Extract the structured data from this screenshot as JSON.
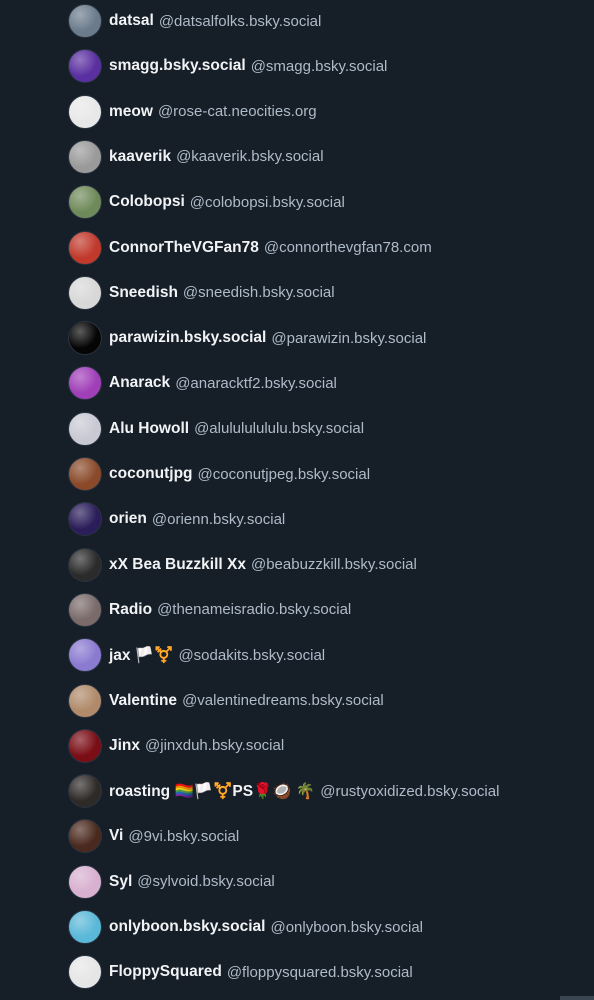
{
  "follows": [
    {
      "display_name": "datsal",
      "handle": "@datsalfolks.bsky.social",
      "avatar_color": "#6b7b8c",
      "avatar_icon": "avatar-icon"
    },
    {
      "display_name": "smagg.bsky.social",
      "handle": "@smagg.bsky.social",
      "avatar_color": "#5a2fa0",
      "avatar_icon": "avatar-icon"
    },
    {
      "display_name": "meow",
      "handle": "@rose-cat.neocities.org",
      "avatar_color": "#e8e8e8",
      "avatar_icon": "avatar-icon"
    },
    {
      "display_name": "kaaverik",
      "handle": "@kaaverik.bsky.social",
      "avatar_color": "#9a9a9a",
      "avatar_icon": "avatar-icon"
    },
    {
      "display_name": "Colobopsi",
      "handle": "@colobopsi.bsky.social",
      "avatar_color": "#6f8a5a",
      "avatar_icon": "avatar-icon"
    },
    {
      "display_name": "ConnorTheVGFan78",
      "handle": "@connorthevgfan78.com",
      "avatar_color": "#c0392b",
      "avatar_icon": "avatar-icon"
    },
    {
      "display_name": "Sneedish",
      "handle": "@sneedish.bsky.social",
      "avatar_color": "#d8d8d8",
      "avatar_icon": "avatar-icon"
    },
    {
      "display_name": "parawizin.bsky.social",
      "handle": "@parawizin.bsky.social",
      "avatar_color": "#050505",
      "avatar_icon": "avatar-icon"
    },
    {
      "display_name": "Anarack",
      "handle": "@anaracktf2.bsky.social",
      "avatar_color": "#a03fb8",
      "avatar_icon": "avatar-icon"
    },
    {
      "display_name": "Alu Howoll",
      "handle": "@alulululululu.bsky.social",
      "avatar_color": "#c9c9d4",
      "avatar_icon": "avatar-icon"
    },
    {
      "display_name": "coconutjpg",
      "handle": "@coconutjpeg.bsky.social",
      "avatar_color": "#8a4a2a",
      "avatar_icon": "avatar-icon"
    },
    {
      "display_name": "orien",
      "handle": "@orienn.bsky.social",
      "avatar_color": "#2a1d5a",
      "avatar_icon": "avatar-icon"
    },
    {
      "display_name": "xX Bea Buzzkill Xx",
      "handle": "@beabuzzkill.bsky.social",
      "avatar_color": "#2b2b2b",
      "avatar_icon": "avatar-icon"
    },
    {
      "display_name": "Radio",
      "handle": "@thenameisradio.bsky.social",
      "avatar_color": "#7a6a6a",
      "avatar_icon": "avatar-icon"
    },
    {
      "display_name": "jax 🏳️⚧️",
      "handle": "@sodakits.bsky.social",
      "avatar_color": "#8a7ad0",
      "avatar_icon": "avatar-icon"
    },
    {
      "display_name": "Valentine",
      "handle": "@valentinedreams.bsky.social",
      "avatar_color": "#b08a6a",
      "avatar_icon": "avatar-icon"
    },
    {
      "display_name": "Jinx",
      "handle": "@jinxduh.bsky.social",
      "avatar_color": "#7a0d15",
      "avatar_icon": "avatar-icon"
    },
    {
      "display_name": "roasting 🏳️‍🌈🏳️⚧️PS🌹🥥 🌴",
      "handle": "@rustyoxidized.bsky.social",
      "avatar_color": "#2e2a28",
      "avatar_icon": "avatar-icon"
    },
    {
      "display_name": "Vi",
      "handle": "@9vi.bsky.social",
      "avatar_color": "#4a2a1e",
      "avatar_icon": "avatar-icon"
    },
    {
      "display_name": "Syl",
      "handle": "@sylvoid.bsky.social",
      "avatar_color": "#d8b0d0",
      "avatar_icon": "avatar-icon"
    },
    {
      "display_name": "onlyboon.bsky.social",
      "handle": "@onlyboon.bsky.social",
      "avatar_color": "#5ab8d8",
      "avatar_icon": "avatar-icon"
    },
    {
      "display_name": "FloppySquared",
      "handle": "@floppysquared.bsky.social",
      "avatar_color": "#e6e6e6",
      "avatar_icon": "avatar-icon"
    }
  ],
  "colors": {
    "background": "#161e27",
    "name_text": "#f1f3f5",
    "handle_text": "#aebbc9"
  }
}
